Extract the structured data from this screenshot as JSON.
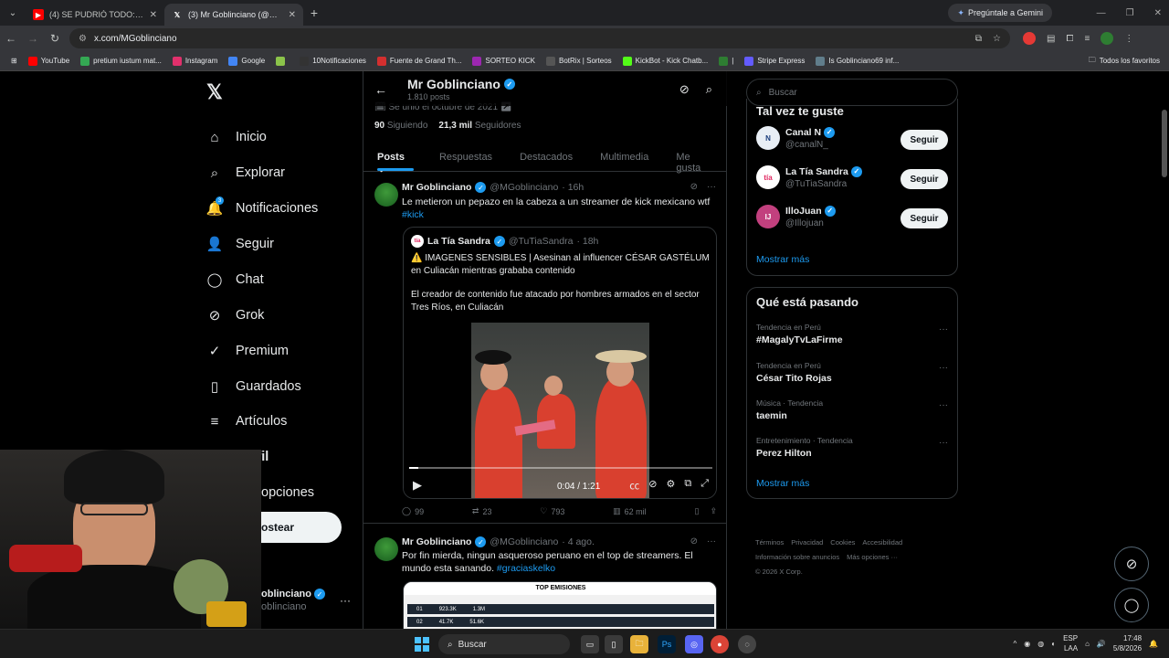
{
  "browser": {
    "tabs": [
      {
        "title": "(4) SE PUDRIÓ TODO: ¡Asegura",
        "icon": "youtube-icon",
        "active": false
      },
      {
        "title": "(3) Mr Goblinciano (@MGoblin",
        "icon": "x-icon",
        "active": true
      }
    ],
    "gemini_label": "Pregúntale a Gemini",
    "url": "x.com/MGoblinciano",
    "bookmarks": [
      {
        "label": "YouTube",
        "color": "#ff0000"
      },
      {
        "label": "pretium iustum mat...",
        "color": "#34a853"
      },
      {
        "label": "Instagram",
        "color": "#e1306c"
      },
      {
        "label": "Google",
        "color": "#4285f4"
      },
      {
        "label": "",
        "color": "#8bc34a"
      },
      {
        "label": "10Notificaciones",
        "color": "#333333"
      },
      {
        "label": "Fuente de Grand Th...",
        "color": "#d32f2f"
      },
      {
        "label": "SORTEO KICK",
        "color": "#9c27b0"
      },
      {
        "label": "BotRix | Sorteos",
        "color": "#555555"
      },
      {
        "label": "KickBot - Kick Chatb...",
        "color": "#53fc18"
      },
      {
        "label": "|",
        "color": "#2e7d32"
      },
      {
        "label": "Stripe Express",
        "color": "#635bff"
      },
      {
        "label": "Is Goblinciano69 inf...",
        "color": "#607d8b"
      }
    ],
    "bookmarks_right": "Todos los favoritos"
  },
  "nav": {
    "items": [
      {
        "label": "Inicio",
        "icon": "home-icon",
        "glyph": "⌂"
      },
      {
        "label": "Explorar",
        "icon": "search-icon",
        "glyph": "⌕"
      },
      {
        "label": "Notificaciones",
        "icon": "bell-icon",
        "glyph": "🔔"
      },
      {
        "label": "Seguir",
        "icon": "person-add-icon",
        "glyph": "👤"
      },
      {
        "label": "Chat",
        "icon": "chat-icon",
        "glyph": "◯"
      },
      {
        "label": "Grok",
        "icon": "grok-icon",
        "glyph": "⊘"
      },
      {
        "label": "Premium",
        "icon": "premium-icon",
        "glyph": "✓"
      },
      {
        "label": "Guardados",
        "icon": "bookmark-icon",
        "glyph": "▯"
      },
      {
        "label": "Artículos",
        "icon": "articles-icon",
        "glyph": "≡"
      },
      {
        "label": "Perfil",
        "icon": "profile-icon",
        "glyph": "●"
      },
      {
        "label": "opciones",
        "icon": "more-options-icon",
        "glyph": ""
      }
    ],
    "notif_badge": "3",
    "post_button": "ostear",
    "account_name": "oblinciano",
    "account_handle": "oblinciano"
  },
  "profile": {
    "name": "Mr Goblinciano",
    "posts_count": "1.810 posts",
    "joined": "Se unió el octubre de 2021",
    "following_count": "90",
    "following_label": "Siguiendo",
    "followers_count": "21,3 mil",
    "followers_label": "Seguidores",
    "tabs": [
      "Posts",
      "Respuestas",
      "Destacados",
      "Multimedia",
      "Me gusta"
    ]
  },
  "tweets": [
    {
      "name": "Mr Goblinciano",
      "handle": "@MGoblinciano",
      "time": "· 16h",
      "text": "Le metieron un pepazo en la cabeza a un streamer de kick mexicano wtf",
      "hashtag": "#kick",
      "quote": {
        "name": "La Tía Sandra",
        "handle": "@TuTiaSandra",
        "time": "· 18h",
        "line1": "⚠️ IMAGENES SENSIBLES |  Asesinan al influencer CÉSAR GASTÉLUM en Culiacán mientras grababa contenido",
        "line2": "El creador de contenido fue atacado por hombres armados en el sector Tres Ríos, en Culiacán",
        "video_time": "0:04 / 1:21",
        "progress": 0.03
      },
      "replies": "99",
      "reposts": "23",
      "likes": "793",
      "views": "62 mil"
    },
    {
      "name": "Mr Goblinciano",
      "handle": "@MGoblinciano",
      "time": "· 4 ago.",
      "text": "Por fin mierda, ningun asqueroso peruano en el top de streamers. El mundo esta sanando.",
      "hashtag": "#graciaskelko",
      "card_title": "TOP EMISIONES",
      "card_rows": [
        {
          "rank": "01",
          "value": "923.3K",
          "peak": "1.3M"
        },
        {
          "rank": "02",
          "value": "41.7K",
          "peak": "51.6K"
        }
      ]
    }
  ],
  "right": {
    "search_placeholder": "Buscar",
    "who_title": "Tal vez te guste",
    "who": [
      {
        "name": "Canal N",
        "handle": "@canalN_",
        "avatar_bg": "#e8eef5",
        "avatar_text": "N",
        "avatar_color": "#1a3d7c"
      },
      {
        "name": "La Tía Sandra",
        "handle": "@TuTiaSandra",
        "avatar_bg": "#ffffff",
        "avatar_text": "tía",
        "avatar_color": "#e0245e"
      },
      {
        "name": "IlloJuan",
        "handle": "@Illojuan",
        "avatar_bg": "#c2407e",
        "avatar_text": "IJ",
        "avatar_color": "#ffffff"
      }
    ],
    "follow_label": "Seguir",
    "show_more": "Mostrar más",
    "trends_title": "Qué está pasando",
    "trends": [
      {
        "category": "Tendencia en Perú",
        "name": "#MagalyTvLaFirme"
      },
      {
        "category": "Tendencia en Perú",
        "name": "César Tito Rojas"
      },
      {
        "category": "Música · Tendencia",
        "name": "taemin"
      },
      {
        "category": "Entretenimiento · Tendencia",
        "name": "Perez Hilton"
      }
    ],
    "footer": [
      "Términos",
      "Privacidad",
      "Cookies",
      "Accesibilidad",
      "Información sobre anuncios",
      "Más opciones ···",
      "© 2026 X Corp."
    ]
  },
  "taskbar": {
    "search": "Buscar",
    "lang1": "ESP",
    "lang2": "LAA",
    "time": "17:48",
    "date": "5/8/2026"
  }
}
